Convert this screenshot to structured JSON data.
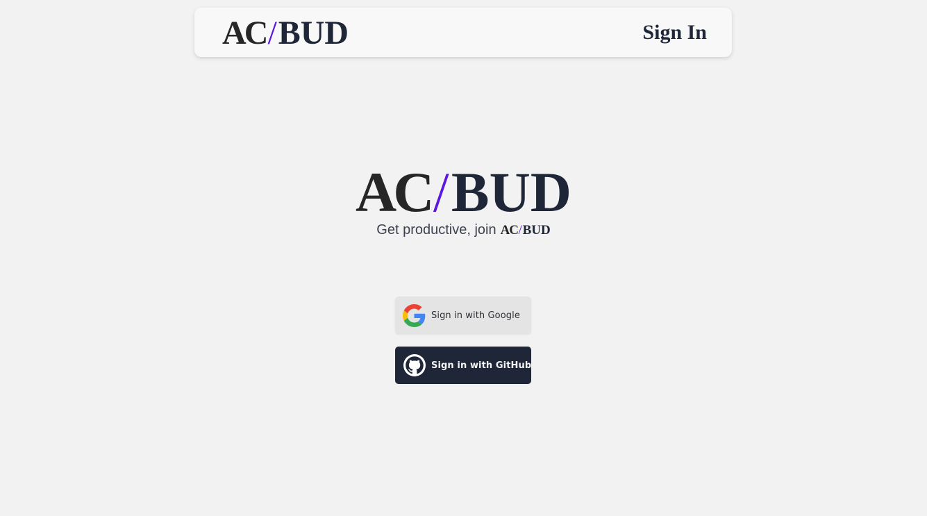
{
  "brand": {
    "part1": "AC",
    "slash": "/",
    "part2": "BUD",
    "colors": {
      "ac": "#262626",
      "slash": "#5b16e0",
      "bud": "#1e2637"
    }
  },
  "navbar": {
    "signin_label": "Sign In"
  },
  "hero": {
    "tagline": "Get productive, join"
  },
  "auth": {
    "google": {
      "label": "Sign in with Google",
      "icon": "google-icon",
      "background": "#e4e4e4"
    },
    "github": {
      "label": "Sign in with GitHub",
      "icon": "github-icon",
      "background": "#1e2637"
    }
  }
}
